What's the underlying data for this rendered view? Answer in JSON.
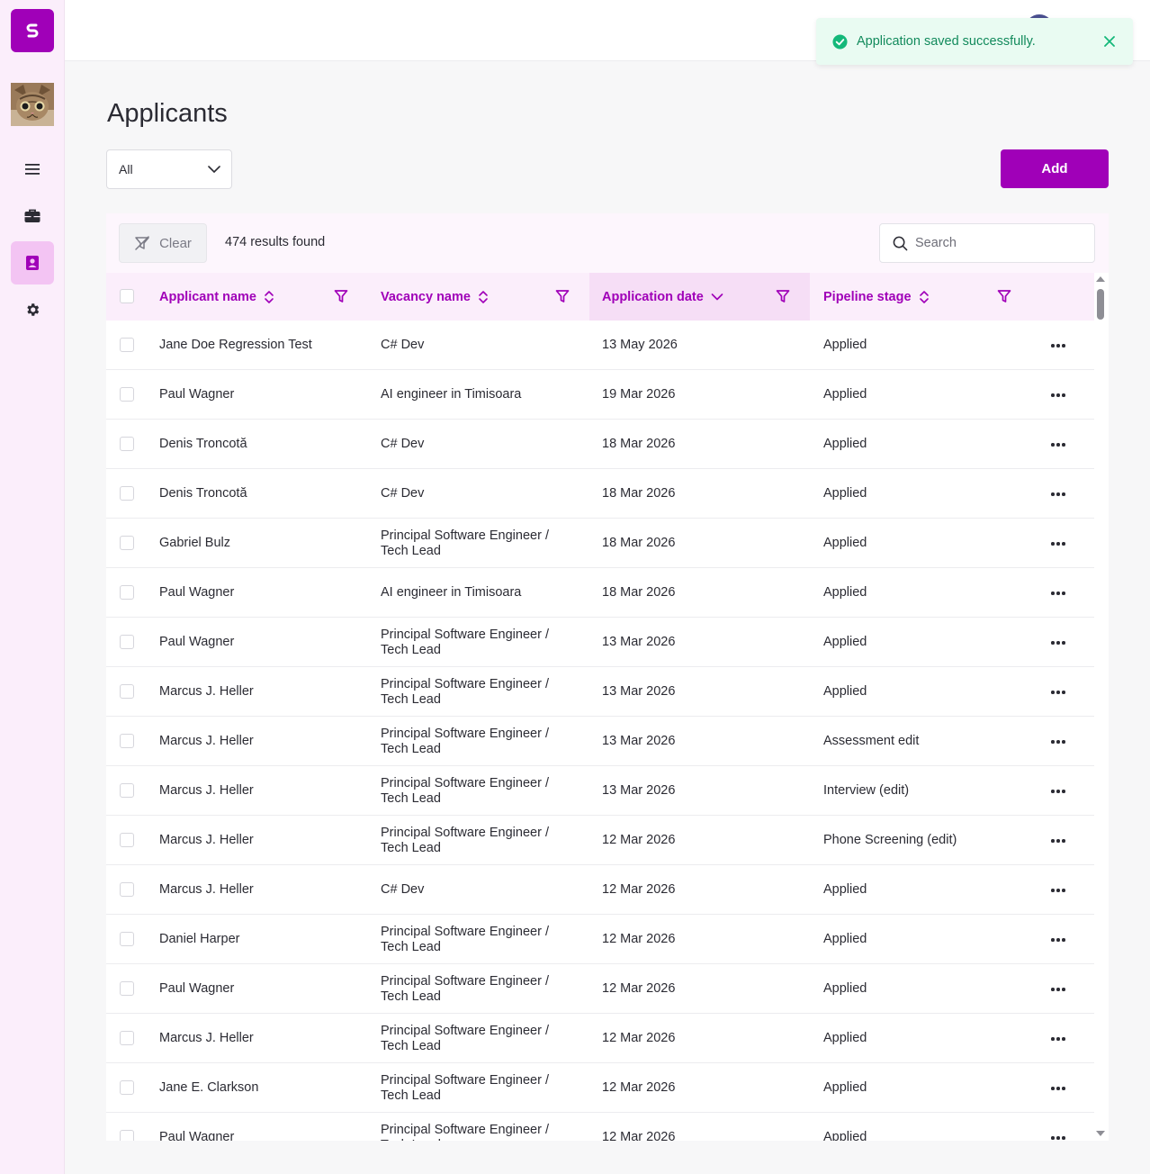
{
  "sidebar": {
    "logo_letter": "S",
    "brand_color": "#a000b8",
    "icons": [
      "menu-icon",
      "briefcase-icon",
      "contacts-icon",
      "gear-icon"
    ]
  },
  "toast": {
    "message": "Application saved successfully.",
    "status_color": "#14b87a"
  },
  "page": {
    "title": "Applicants"
  },
  "filter_select": {
    "value": "All"
  },
  "add_button": {
    "label": "Add"
  },
  "toolbar": {
    "clear_label": "Clear",
    "results_text": "474 results found",
    "search_placeholder": "Search"
  },
  "columns": {
    "applicant": "Applicant name",
    "vacancy": "Vacancy name",
    "date": "Application date",
    "stage": "Pipeline stage"
  },
  "rows": [
    {
      "name": "Jane Doe Regression Test",
      "vacancy": "C# Dev",
      "vacancy2": "",
      "date": "13 May 2026",
      "stage": "Applied"
    },
    {
      "name": "Paul Wagner",
      "vacancy": "AI engineer in Timisoara",
      "vacancy2": "",
      "date": "19 Mar 2026",
      "stage": "Applied"
    },
    {
      "name": "Denis Troncotă",
      "vacancy": "C# Dev",
      "vacancy2": "",
      "date": "18 Mar 2026",
      "stage": "Applied"
    },
    {
      "name": "Denis Troncotă",
      "vacancy": "C# Dev",
      "vacancy2": "",
      "date": "18 Mar 2026",
      "stage": "Applied"
    },
    {
      "name": "Gabriel Bulz",
      "vacancy": "Principal Software Engineer /",
      "vacancy2": "Tech Lead",
      "date": "18 Mar 2026",
      "stage": "Applied"
    },
    {
      "name": "Paul Wagner",
      "vacancy": "AI engineer in Timisoara",
      "vacancy2": "",
      "date": "18 Mar 2026",
      "stage": "Applied"
    },
    {
      "name": "Paul Wagner",
      "vacancy": "Principal Software Engineer /",
      "vacancy2": "Tech Lead",
      "date": "13 Mar 2026",
      "stage": "Applied"
    },
    {
      "name": "Marcus J. Heller",
      "vacancy": "Principal Software Engineer /",
      "vacancy2": "Tech Lead",
      "date": "13 Mar 2026",
      "stage": "Applied"
    },
    {
      "name": "Marcus J. Heller",
      "vacancy": "Principal Software Engineer /",
      "vacancy2": "Tech Lead",
      "date": "13 Mar 2026",
      "stage": "Assessment edit"
    },
    {
      "name": "Marcus J. Heller",
      "vacancy": "Principal Software Engineer /",
      "vacancy2": "Tech Lead",
      "date": "13 Mar 2026",
      "stage": "Interview (edit)"
    },
    {
      "name": "Marcus J. Heller",
      "vacancy": "Principal Software Engineer /",
      "vacancy2": "Tech Lead",
      "date": "12 Mar 2026",
      "stage": "Phone Screening (edit)"
    },
    {
      "name": "Marcus J. Heller",
      "vacancy": "C# Dev",
      "vacancy2": "",
      "date": "12 Mar 2026",
      "stage": "Applied"
    },
    {
      "name": "Daniel Harper",
      "vacancy": "Principal Software Engineer /",
      "vacancy2": "Tech Lead",
      "date": "12 Mar 2026",
      "stage": "Applied"
    },
    {
      "name": "Paul Wagner",
      "vacancy": "Principal Software Engineer /",
      "vacancy2": "Tech Lead",
      "date": "12 Mar 2026",
      "stage": "Applied"
    },
    {
      "name": "Marcus J. Heller",
      "vacancy": "Principal Software Engineer /",
      "vacancy2": "Tech Lead",
      "date": "12 Mar 2026",
      "stage": "Applied"
    },
    {
      "name": "Jane E. Clarkson",
      "vacancy": "Principal Software Engineer /",
      "vacancy2": "Tech Lead",
      "date": "12 Mar 2026",
      "stage": "Applied"
    },
    {
      "name": "Paul Wagner",
      "vacancy": "Principal Software Engineer /",
      "vacancy2": "Tech Lead",
      "date": "12 Mar 2026",
      "stage": "Applied"
    }
  ]
}
